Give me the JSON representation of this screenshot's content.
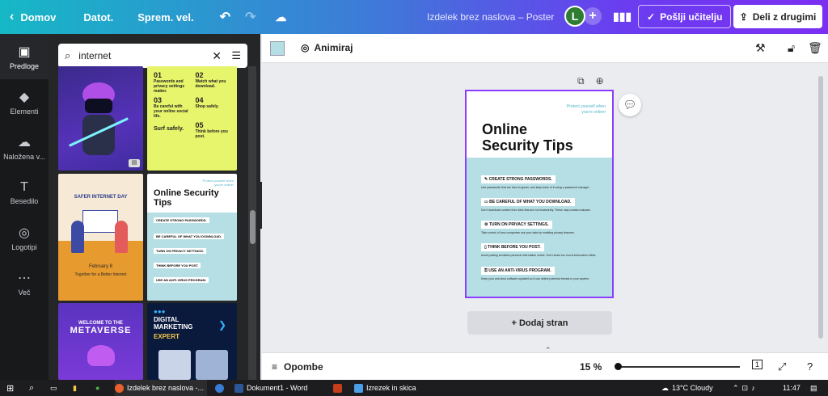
{
  "topbar": {
    "home_label": "Domov",
    "file_label": "Datot.",
    "resize_label": "Sprem. vel.",
    "doc_title": "Izdelek brez naslova – Poster",
    "avatar_letter": "L",
    "send_label": "Pošlji učitelju",
    "share_label": "Deli z drugimi"
  },
  "rail": {
    "items": [
      {
        "label": "Predloge",
        "icon": "▣"
      },
      {
        "label": "Elementi",
        "icon": "◆"
      },
      {
        "label": "Naložena v...",
        "icon": "☁"
      },
      {
        "label": "Besedilo",
        "icon": "T"
      },
      {
        "label": "Logotipi",
        "icon": "◎"
      },
      {
        "label": "Več",
        "icon": "⋯"
      }
    ]
  },
  "panel": {
    "search_value": "internet",
    "tiles": {
      "list_items": [
        {
          "num": "01",
          "text": "Passwords and privacy settings matter."
        },
        {
          "num": "02",
          "text": "Watch what you download."
        },
        {
          "num": "03",
          "text": "Be careful with your online social life."
        },
        {
          "num": "04",
          "text": "Shop safely."
        },
        {
          "num": "05",
          "text": "Think before you post."
        }
      ],
      "surf_text": "Surf safely.",
      "safer_title": "SAFER INTERNET DAY",
      "safer_date": "February 8",
      "safer_sub": "Together for a Better Internet",
      "online_title": "Online Security Tips",
      "online_tag": "Protect yourself when you're online!",
      "online_tips": [
        "CREATE STRONG PASSWORDS.",
        "BE CAREFUL OF WHAT YOU DOWNLOAD.",
        "TURN ON PRIVACY SETTINGS.",
        "THINK BEFORE YOU POST.",
        "USE AN ANTI-VIRUS PROGRAM."
      ],
      "meta_welcome": "WELCOME TO THE",
      "meta_title": "METAVERSE",
      "digital_title": "DIGITAL MARKETING",
      "digital_expert": "EXPERT"
    }
  },
  "toolbar": {
    "animate_label": "Animiraj",
    "swatch_color": "#b6dfe5"
  },
  "page": {
    "tagline": "Protect yourself when you're online!",
    "title_line1": "Online",
    "title_line2": "Security Tips",
    "tips": [
      {
        "icon": "✎",
        "title": "CREATE STRONG PASSWORDS.",
        "body": "Use passwords that are hard to guess, and keep track of it using a password manager."
      },
      {
        "icon": "▭",
        "title": "BE CAREFUL OF WHAT YOU DOWNLOAD.",
        "body": "Don't download content from sites that are not trustworthy. These may contain malware."
      },
      {
        "icon": "⚙",
        "title": "TURN ON PRIVACY SETTINGS.",
        "body": "Take control of how companies use your data by enabling privacy features."
      },
      {
        "icon": "▯",
        "title": "THINK BEFORE YOU POST.",
        "body": "Avoid posting sensitive personal information online. Don't share too much information either."
      },
      {
        "icon": "⚿",
        "title": "USE AN ANTI-VIRUS PROGRAM.",
        "body": "Keep your anti-virus software updated so it can detect potential threats in your system."
      }
    ]
  },
  "canvas": {
    "add_page_label": "+ Dodaj stran"
  },
  "bottombar": {
    "notes_label": "Opombe",
    "zoom_value": "15 %",
    "page_count": "1"
  },
  "taskbar": {
    "window1": "Izdelek brez naslova -...",
    "window2": "Dokument1 - Word",
    "window3": "Izrezek in skica",
    "weather": "13°C Cloudy",
    "time": "11:47"
  },
  "colors": {
    "accent": "#8b3dff",
    "page_blue": "#b6dfe5",
    "list_yellow": "#e6f56b"
  }
}
